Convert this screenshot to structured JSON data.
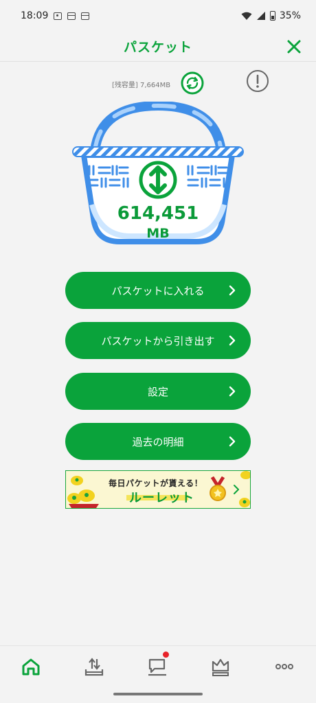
{
  "status_bar": {
    "time": "18:09",
    "battery": "35%"
  },
  "header": {
    "title": "パスケット"
  },
  "capacity": {
    "label": "[残容量] 7,664MB"
  },
  "basket": {
    "value": "614,451",
    "unit": "MB"
  },
  "menu": [
    {
      "label": "パスケットに入れる"
    },
    {
      "label": "パスケットから引き出す"
    },
    {
      "label": "設定"
    },
    {
      "label": "過去の明細"
    }
  ],
  "banner": {
    "top_text": "毎日パケットが貰える！",
    "main_text": "ルーレット"
  },
  "bottom_nav": {
    "items": [
      {
        "icon": "home-icon",
        "active": true
      },
      {
        "icon": "upload-tray-icon",
        "active": false
      },
      {
        "icon": "chat-icon",
        "active": false,
        "badge": true
      },
      {
        "icon": "crown-icon",
        "active": false
      },
      {
        "icon": "more-icon",
        "active": false
      }
    ]
  },
  "colors": {
    "accent": "#0aa33b",
    "basket_blue": "#3f8ee8",
    "badge": "#e8232a"
  }
}
